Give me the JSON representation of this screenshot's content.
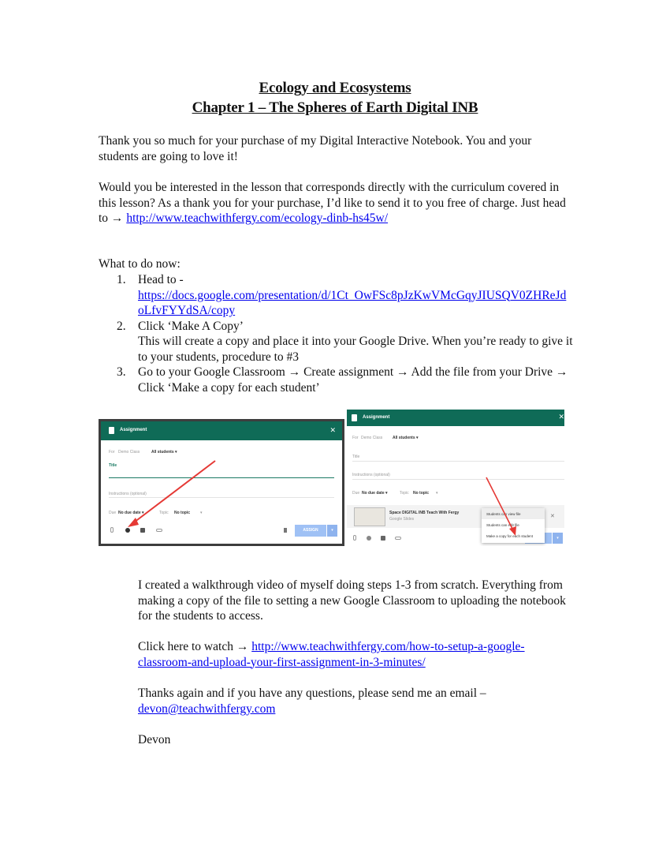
{
  "document": {
    "title_line1": "Ecology and Ecosystems",
    "title_line2": "Chapter 1 – The Spheres of Earth Digital INB",
    "intro": "Thank you so much for your purchase of my Digital Interactive Notebook. You and your students are going to love it!",
    "offer_text": "Would you be interested in the lesson that corresponds directly with the curriculum covered in this lesson? As a thank you for your purchase, I’d like to send it to you free of charge. Just head to → ",
    "offer_link": "http://www.teachwithfergy.com/ecology-dinb-hs45w/",
    "steps_heading": "What to do now:",
    "steps": [
      {
        "num": "1.",
        "text": "Head to -",
        "link": "https://docs.google.com/presentation/d/1Ct_OwFSc8pJzKwVMcGqyJIUSQV0ZHReJdoLfvFYYdSA/copy"
      },
      {
        "num": "2.",
        "text": "Click ‘Make A Copy’",
        "detail": "This will create a copy and place it into your Google Drive. When you’re ready to give it to your students, procedure to #3"
      },
      {
        "num": "3.",
        "text": "Go to your Google Classroom → Create assignment → Add the file from your Drive → Click ‘Make a copy for each student’"
      }
    ],
    "video_text": "I created a walkthrough video of myself doing steps 1-3 from scratch. Everything from making a copy of the file to setting a new Google Classroom to uploading the notebook for the students to access.",
    "watch_text": "Click here to watch → ",
    "watch_link": "http://www.teachwithfergy.com/how-to-setup-a-google-classroom-and-upload-your-first-assignment-in-3-minutes/",
    "thanks_text": "Thanks again and if you have any questions, please send me an email – ",
    "email_link": "devon@teachwithfergy.com",
    "signature": "Devon"
  },
  "screenshot1": {
    "header_title": "Assignment",
    "close_glyph": "✕",
    "for_label": "For",
    "class_name": "Demo Class",
    "students": "All students ▾",
    "title_label": "Title",
    "instructions": "Instructions (optional)",
    "due_label": "Due",
    "due_value": "No due date ▾",
    "topic_label": "Topic",
    "topic_value": "No topic",
    "topic_arrow": "▾",
    "assign_button": "ASSIGN",
    "assign_dropdown": "▾"
  },
  "screenshot2": {
    "header_title": "Assignment",
    "close_glyph": "✕",
    "for_label": "For",
    "class_name": "Demo Class",
    "students": "All students ▾",
    "title_label": "Title",
    "instructions": "Instructions (optional)",
    "due_label": "Due",
    "due_value": "No due date ▾",
    "topic_label": "Topic",
    "topic_value": "No topic",
    "topic_arrow": "▾",
    "file_name": "Space DIGITAL INB Teach With Fergy",
    "file_type": "Google Slides",
    "remove_glyph": "✕",
    "menu_items": [
      "Students can view file",
      "Students can edit file",
      "Make a copy for each student"
    ],
    "assign_dropdown": "▾"
  },
  "colors": {
    "classroom_green": "#0f6b57",
    "link_blue": "#0000ee",
    "arrow_red": "#e53935",
    "assign_blue": "#9fc1f5"
  }
}
